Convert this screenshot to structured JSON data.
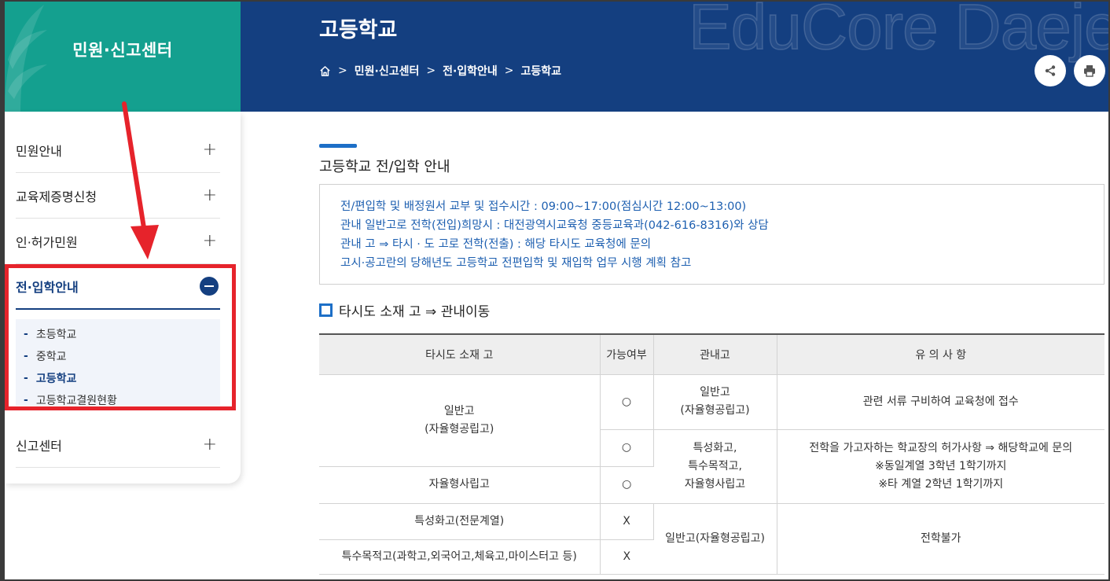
{
  "sidebar": {
    "title": "민원·신고센터",
    "items": [
      {
        "label": "민원안내",
        "icon": "plus-icon"
      },
      {
        "label": "교육제증명신청",
        "icon": "plus-icon"
      },
      {
        "label": "인·허가민원",
        "icon": "plus-icon"
      },
      {
        "label": "전·입학안내",
        "icon": "minus-circle-icon"
      },
      {
        "label": "신고센터",
        "icon": "plus-icon"
      }
    ],
    "sub_items": [
      "초등학교",
      "중학교",
      "고등학교",
      "고등학교결원현황"
    ],
    "current_sub": "고등학교"
  },
  "banner": {
    "title": "고등학교",
    "watermark": "EduCore Daejeon",
    "breadcrumb": [
      "민원·신고센터",
      "전·입학안내",
      "고등학교"
    ],
    "buttons": [
      "share-icon",
      "print-icon"
    ]
  },
  "content": {
    "section_title": "고등학교 전/입학 안내",
    "info_lines": [
      "전/편입학 및 배정원서 교부 및 접수시간 : 09:00~17:00(점심시간 12:00~13:00)",
      "관내 일반고로 전학(전입)희망시 : 대전광역시교육청 중등교육과(042-616-8316)와 상담",
      "관내 고 ⇒ 타시 · 도 고로 전학(전출) : 해당 타시도 교육청에 문의",
      "고시·공고란의 당해년도 고등학교 전편입학 및 재입학 업무 시행 계획 참고"
    ],
    "table_title": "타시도 소재 고 ⇒ 관내이동"
  },
  "table": {
    "headers": [
      "타시도 소재 고",
      "가능여부",
      "관내고",
      "유 의 사 항"
    ],
    "row1_source": "일반고\n(자율형공립고)",
    "row1_available": "○",
    "row1_target": "일반고\n(자율형공립고)",
    "row1_note": "관련 서류 구비하여 교육청에 접수",
    "row2_available": "○",
    "row2_target": "특성화고,\n특수목적고,\n자율형사립고",
    "row2_note": "전학을 가고자하는 학교장의 허가사항 ⇒ 해당학교에 문의\n※동일계열 3학년 1학기까지\n※타 계열 2학년 1학기까지",
    "row3_source": "자율형사립고",
    "row3_available": "○",
    "row4_source": "특성화고(전문계열)",
    "row4_available": "X",
    "row4_target": "일반고(자율형공립고)",
    "row4_note": "전학불가",
    "row5_source": "특수목적고(과학고,외국어고,체육고,마이스터고 등)",
    "row5_available": "X"
  },
  "colors": {
    "sidebar_header": "#14a08f",
    "banner": "#143f80",
    "info_text": "#1d5fb0",
    "highlight": "#e6232b"
  }
}
